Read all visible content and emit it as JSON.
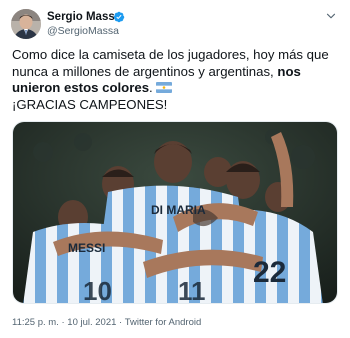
{
  "author": {
    "name": "Sergio Massa",
    "handle": "@SergioMassa",
    "verified": true
  },
  "tweet": {
    "text_plain_1": "Como dice la camiseta de los jugadores, hoy más que nunca a millones de argentinos y argentinas, ",
    "text_bold": "nos unieron estos colores",
    "text_plain_2": ".",
    "text_line_2": "¡GRACIAS CAMPEONES!",
    "flag_icon": "argentina-flag-emoji"
  },
  "media": {
    "jersey_names": [
      "DI MARIA",
      "MESSI",
      "22"
    ]
  },
  "meta": {
    "time": "11:25 p. m.",
    "separator": "·",
    "date": "10 jul. 2021",
    "source": "Twitter for Android"
  },
  "colors": {
    "text": "#0f1419",
    "secondary": "#536471",
    "verified": "#1d9bf0",
    "jersey_blue": "#75aadb"
  }
}
